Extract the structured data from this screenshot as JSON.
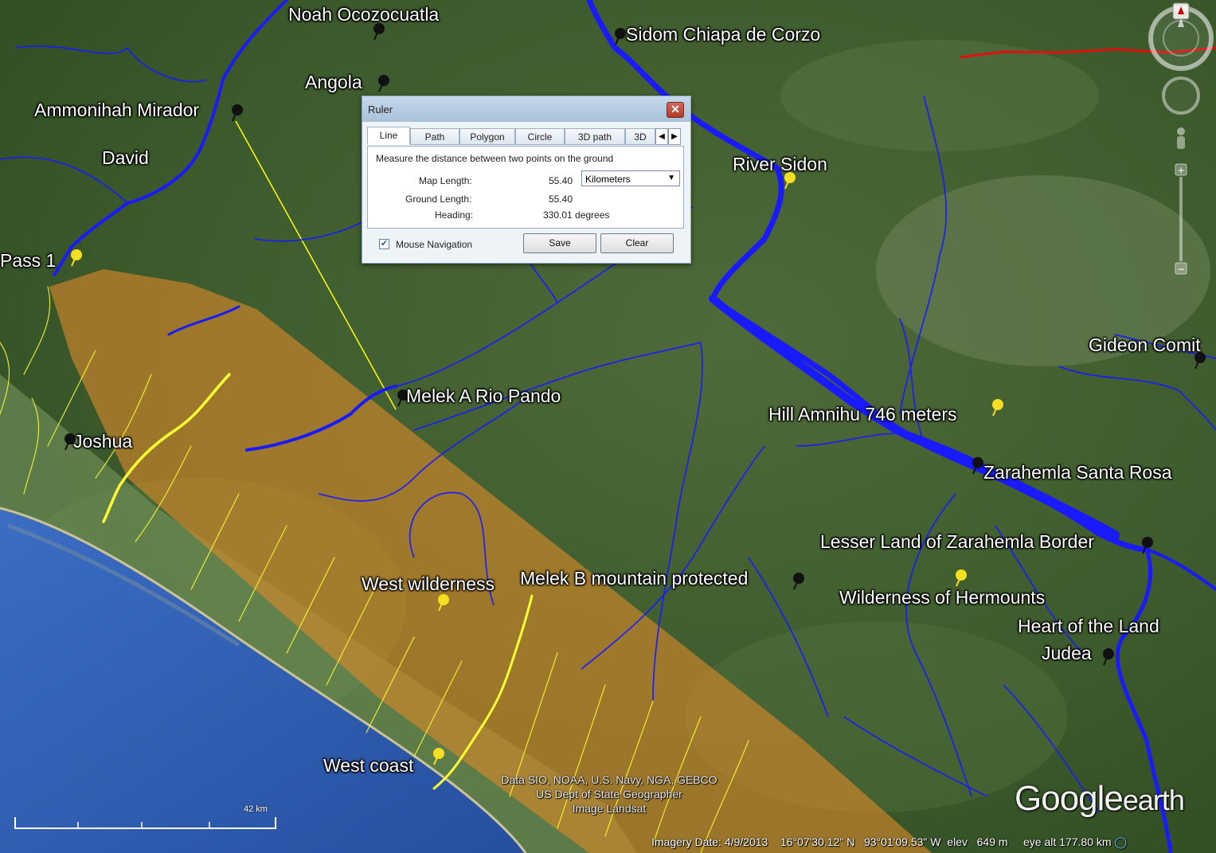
{
  "map": {
    "placemarks": [
      {
        "label": "Noah Ocozocuatla",
        "pin": "black"
      },
      {
        "label": "Sidom Chiapa de Corzo",
        "pin": "black"
      },
      {
        "label": "Angola",
        "pin": "black"
      },
      {
        "label": "Ammonihah Mirador",
        "pin": "black"
      },
      {
        "label": "David",
        "pin": "none"
      },
      {
        "label": "River Sidon",
        "pin": "yellow"
      },
      {
        "label": "Pass 1",
        "pin": "yellow"
      },
      {
        "label": "Gideon Comit",
        "pin": "black"
      },
      {
        "label": "Melek A Rio Pando",
        "pin": "black"
      },
      {
        "label": "Hill Amnihu 746 meters",
        "pin": "yellow"
      },
      {
        "label": "Joshua",
        "pin": "black"
      },
      {
        "label": "Zarahemla Santa Rosa",
        "pin": "black"
      },
      {
        "label": "Lesser Land of Zarahemla Border",
        "pin": "black"
      },
      {
        "label": "West wilderness",
        "pin": "yellow"
      },
      {
        "label": "Melek B mountain protected",
        "pin": "black"
      },
      {
        "label": "Wilderness of Hermounts",
        "pin": "yellow"
      },
      {
        "label": "Heart of the Land",
        "pin": "none"
      },
      {
        "label": "Judea",
        "pin": "black"
      },
      {
        "label": "West coast",
        "pin": "yellow"
      }
    ],
    "colors": {
      "river": "#1a1aff",
      "coast_river": "#ffff33",
      "highlight_zone": "#d9892a",
      "ocean": "#2d5fb8",
      "land": "#3d5e2a",
      "border_line": "#e01010",
      "ruler_line": "#ffff00"
    }
  },
  "ruler": {
    "title": "Ruler",
    "close_label": "✕",
    "tabs": [
      "Line",
      "Path",
      "Polygon",
      "Circle",
      "3D path",
      "3D"
    ],
    "active_tab": "Line",
    "instruction": "Measure the distance between two points on the ground",
    "map_length_label": "Map Length:",
    "map_length_value": "55.40",
    "unit": "Kilometers",
    "ground_length_label": "Ground Length:",
    "ground_length_value": "55.40",
    "heading_label": "Heading:",
    "heading_value": "330.01 degrees",
    "mouse_nav_label": "Mouse Navigation",
    "mouse_nav_checked": true,
    "save_label": "Save",
    "clear_label": "Clear"
  },
  "credits": {
    "line1": "Data SIO, NOAA, U.S. Navy, NGA, GEBCO",
    "line2": "US Dept of State Geographer",
    "line3": "Image Landsat"
  },
  "logo": {
    "word1": "Google",
    "word2": "earth"
  },
  "scale": {
    "label": "42 km"
  },
  "status": {
    "imagery_date": "Imagery Date: 4/9/2013",
    "lat": "16°07'30.12\" N",
    "lon": "93°01'09.53\" W",
    "elev_label": "elev",
    "elev_value": "649 m",
    "eye_alt": "eye alt 177.80 km"
  },
  "nav": {
    "north_label": "N"
  }
}
